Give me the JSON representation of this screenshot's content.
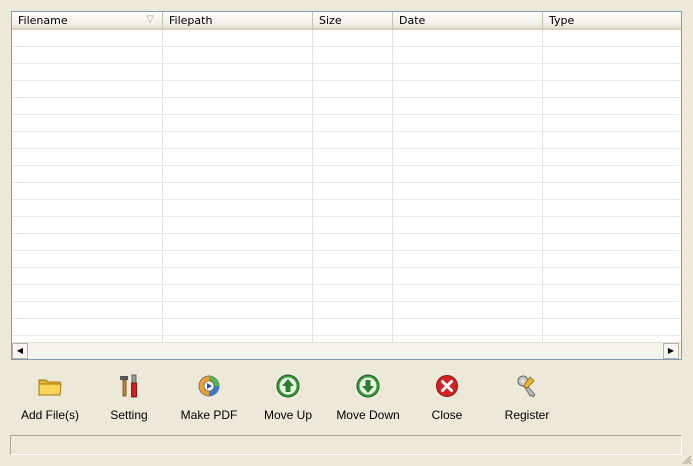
{
  "list": {
    "columns": [
      {
        "label": "Filename",
        "sorted": true
      },
      {
        "label": "Filepath"
      },
      {
        "label": "Size"
      },
      {
        "label": "Date"
      },
      {
        "label": "Type"
      }
    ],
    "rows": []
  },
  "toolbar": {
    "add_files": {
      "label": "Add File(s)",
      "icon": "folder-icon"
    },
    "setting": {
      "label": "Setting",
      "icon": "tools-icon"
    },
    "make_pdf": {
      "label": "Make PDF",
      "icon": "make-pdf-icon"
    },
    "move_up": {
      "label": "Move Up",
      "icon": "arrow-up-icon"
    },
    "move_down": {
      "label": "Move Down",
      "icon": "arrow-down-icon"
    },
    "close": {
      "label": "Close",
      "icon": "close-icon"
    },
    "register": {
      "label": "Register",
      "icon": "key-icon"
    }
  },
  "statusbar": {
    "text": ""
  },
  "colors": {
    "window_bg": "#ECE9D8",
    "move_green": "#3C9A3C",
    "close_red": "#D32222",
    "folder_yellow": "#F5C842"
  }
}
